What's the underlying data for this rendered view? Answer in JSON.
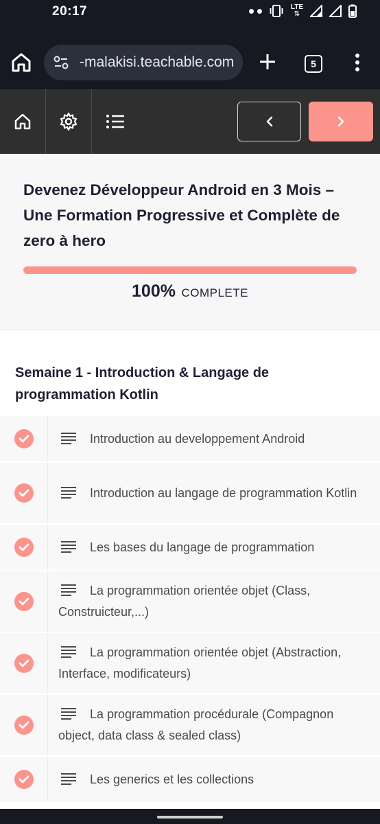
{
  "status_bar": {
    "time": "20:17",
    "network": "LTE"
  },
  "browser": {
    "url": "-malakisi.teachable.com",
    "tab_count": "5"
  },
  "course": {
    "title": "Devenez Développeur Android en 3 Mois – Une Formation Progressive et Complète de zero à hero",
    "progress_percent": "100%",
    "progress_value": 100,
    "progress_word": "COMPLETE"
  },
  "section": {
    "title": "Semaine 1 - Introduction & Langage de programmation Kotlin",
    "lessons": [
      {
        "title": "Introduction au developpement Android",
        "completed": true
      },
      {
        "title": "Introduction au langage de programmation Kotlin",
        "completed": true
      },
      {
        "title": "Les bases du langage de programmation",
        "completed": true
      },
      {
        "title": "La programmation orientée objet (Class, Construicteur,...)",
        "completed": true
      },
      {
        "title": "La programmation orientée objet (Abstraction, Interface, modificateurs)",
        "completed": true
      },
      {
        "title": "La programmation procédurale (Compagnon object, data class & sealed class)",
        "completed": true
      },
      {
        "title": "Les generics et les collections",
        "completed": true
      }
    ]
  },
  "colors": {
    "accent": "#fa948c",
    "nav_bg": "#2f2f2f",
    "browser_bg": "#161822",
    "title_text": "#1e2033"
  }
}
